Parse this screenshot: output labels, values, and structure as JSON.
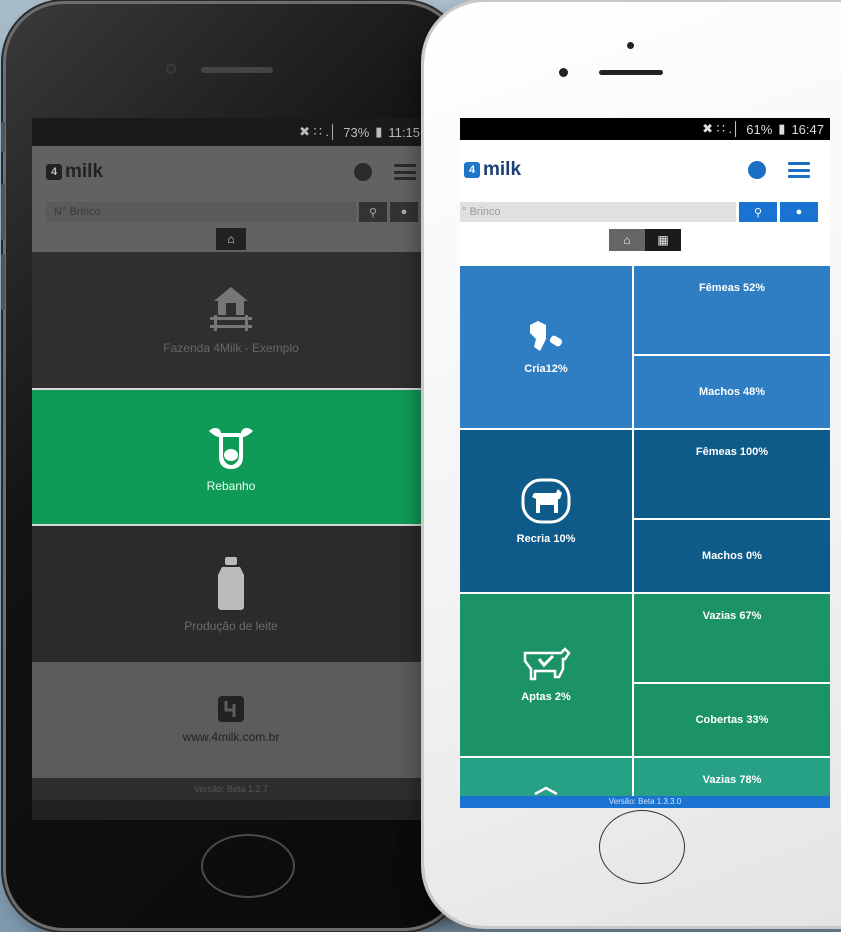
{
  "left_phone": {
    "status": {
      "icons": "✖ ∷ .│",
      "battery": "73%",
      "time": "11:15"
    },
    "header": {
      "logo_text": "milk",
      "logo_mark": "4"
    },
    "search": {
      "placeholder": "N° Brinco"
    },
    "tiles": [
      {
        "label": "Fazenda  4Milk - Exemplo",
        "icon": "farm-house-icon"
      },
      {
        "label": "Rebanho",
        "icon": "cow-head-icon"
      },
      {
        "label": "Produção de leite",
        "icon": "milk-can-icon"
      },
      {
        "label": "www.4milk.com.br",
        "icon": "4milk-logo-icon"
      }
    ],
    "version": "Versão: Beta 1.2.7",
    "colors": {
      "active_tile": "#0f9b57",
      "dark_tile": "#2f2f2f"
    }
  },
  "right_phone": {
    "status": {
      "icons": "✖ ∷ .│",
      "battery": "61%",
      "time": "16:47"
    },
    "header": {
      "logo_text": "milk",
      "logo_mark": "4"
    },
    "search": {
      "placeholder": "° Brinco"
    },
    "categories": [
      {
        "name": "Cria12%",
        "icon": "calf-bottle-icon",
        "sub": [
          "Fêmeas 52%",
          "Machos 48%"
        ],
        "color": "#2f7dc3"
      },
      {
        "name": "Recria 10%",
        "icon": "young-cow-icon",
        "sub": [
          "Fêmeas 100%",
          "Machos 0%"
        ],
        "color": "#0e5a88"
      },
      {
        "name": "Aptas 2%",
        "icon": "cow-check-icon",
        "sub": [
          "Vazias 67%",
          "Cobertas 33%"
        ],
        "color": "#1c9367"
      },
      {
        "name": "",
        "icon": "cow-icon",
        "sub": [
          "Vazias 78%",
          ""
        ],
        "color": "#26a185"
      }
    ],
    "version": "Versão: Beta 1.3.3.0",
    "colors": {
      "accent": "#1a73d1",
      "logo": "#1e3f72"
    }
  }
}
